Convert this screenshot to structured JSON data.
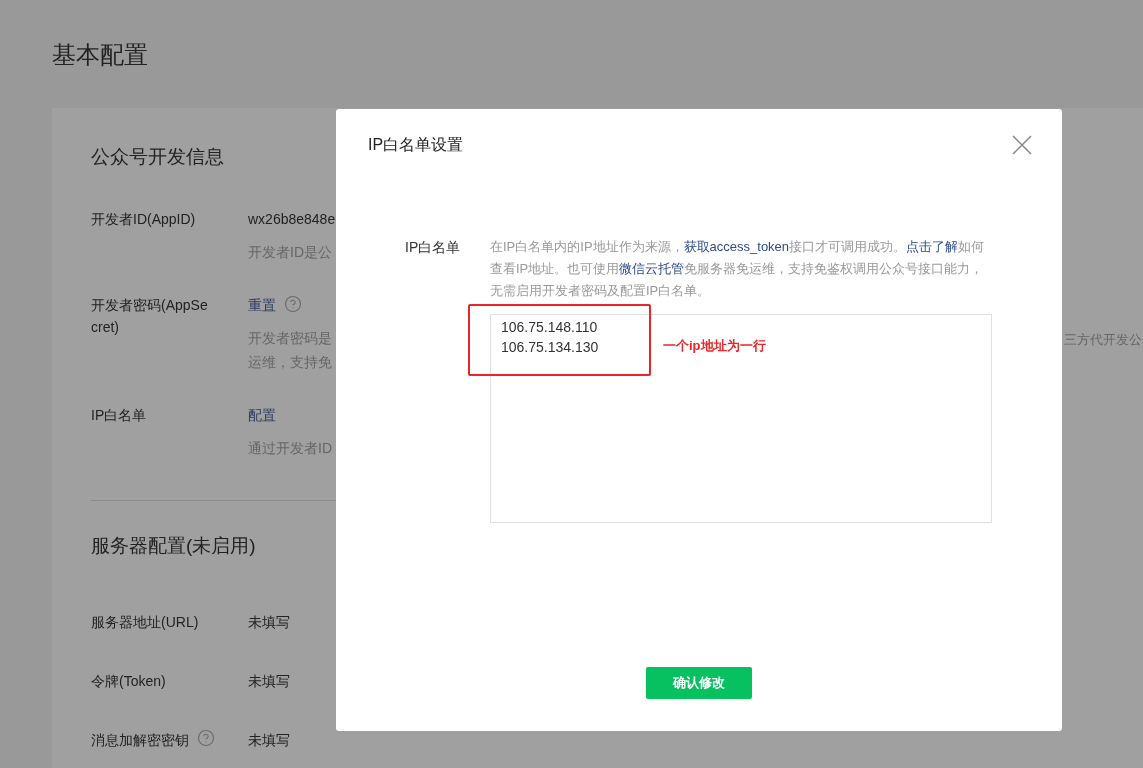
{
  "page": {
    "title": "基本配置"
  },
  "dev_section": {
    "title": "公众号开发信息",
    "rows": [
      {
        "kind": "text",
        "label": "开发者ID(AppID)",
        "value": "wx26b8e848e",
        "desc": [
          "开发者ID是公"
        ]
      },
      {
        "kind": "link_help",
        "label": "开发者密码(AppSecret)",
        "value": "重置",
        "desc": [
          "开发者密码是",
          "运维，支持免"
        ]
      },
      {
        "kind": "link",
        "label": "IP白名单",
        "value": "配置",
        "desc": [
          "通过开发者ID"
        ]
      }
    ],
    "overflow_text": "三方代开发公"
  },
  "server_section": {
    "title": "服务器配置(未启用)",
    "rows": [
      {
        "label": "服务器地址(URL)",
        "help": false,
        "value": "未填写"
      },
      {
        "label": "令牌(Token)",
        "help": false,
        "value": "未填写"
      },
      {
        "label": "消息加解密密钥",
        "help": true,
        "value": "未填写"
      }
    ]
  },
  "dialog": {
    "title": "IP白名单设置",
    "field_label": "IP白名单",
    "description": [
      {
        "kind": "text",
        "text": "在IP白名单内的IP地址作为来源，"
      },
      {
        "kind": "link",
        "text": "获取access_token"
      },
      {
        "kind": "text",
        "text": "接口才可调用成功。"
      },
      {
        "kind": "link",
        "text": "点击了解"
      },
      {
        "kind": "text",
        "text": "如何查看IP地址。也可使用"
      },
      {
        "kind": "link",
        "text": "微信云托管"
      },
      {
        "kind": "text",
        "text": "免服务器免运维，支持免鉴权调用公众号接口能力，无需启用开发者密码及配置IP白名单。"
      }
    ],
    "ip_list": "106.75.148.110\n106.75.134.130",
    "annotation": "一个ip地址为一行",
    "confirm_button": "确认修改"
  }
}
